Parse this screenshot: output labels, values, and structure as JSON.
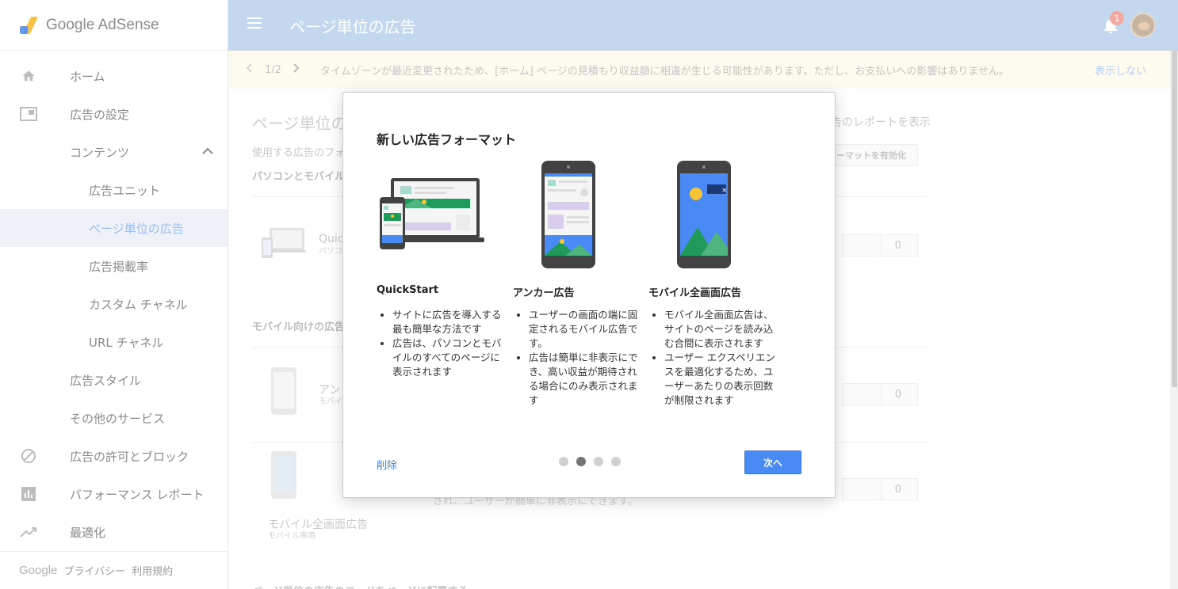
{
  "brand": {
    "name": "Google AdSense"
  },
  "header": {
    "page_title": "ページ単位の広告",
    "notification_count": "1"
  },
  "sidebar": {
    "items": [
      {
        "label": "ホーム",
        "icon": "home-icon"
      },
      {
        "label": "広告の設定",
        "icon": "ads-icon"
      },
      {
        "label": "コンテンツ",
        "icon": "chevron-up-icon"
      },
      {
        "label": "広告ユニット"
      },
      {
        "label": "ページ単位の広告"
      },
      {
        "label": "広告掲載率"
      },
      {
        "label": "カスタム チャネル"
      },
      {
        "label": "URL チャネル"
      },
      {
        "label": "広告スタイル"
      },
      {
        "label": "その他のサービス"
      },
      {
        "label": "広告の許可とブロック",
        "icon": "block-icon"
      },
      {
        "label": "パフォーマンス レポート",
        "icon": "report-icon"
      },
      {
        "label": "最適化",
        "icon": "trending-icon"
      }
    ],
    "footer": {
      "google": "Google",
      "privacy": "プライバシー",
      "terms": "利用規約"
    }
  },
  "notice": {
    "page": "1/2",
    "message": "タイムゾーンが最近変更されたため、[ホーム] ページの見積もり収益額に相違が生じる可能性があります。ただし、お支払いへの影響はありません。",
    "dismiss": "表示しない"
  },
  "main": {
    "title": "ページ単位の広",
    "description": "使用する広告のフォ",
    "section_desktop": "パソコンとモバイル",
    "report_link": "告のレポートを表示",
    "enable_button": "ーマットを有効化",
    "quickstart_label": "Quick",
    "quickstart_sub": "パソコ",
    "section_mobile": "モバイル向けの広告",
    "anchor_label": "アン",
    "anchor_sub": "モバイ",
    "vignette_label": "モバイル全画面広告",
    "vignette_sub": "モバイル専用",
    "vignette_desc": "され、ユーザーが簡単に非表示にできます。",
    "toggle_count_1": "0",
    "toggle_count_2": "0",
    "toggle_count_3": "0",
    "bottom_heading": "ページ単位の広告のコードをページに配置する"
  },
  "dialog": {
    "title": "新しい広告フォーマット",
    "columns": [
      {
        "name": "QuickStart",
        "bullets": [
          "サイトに広告を導入する最も簡単な方法です",
          "広告は、パソコンとモバイルのすべてのページに表示されます"
        ]
      },
      {
        "name": "アンカー広告",
        "bullets": [
          "ユーザーの画面の端に固定されるモバイル広告です。",
          "広告は簡単に非表示にでき、高い収益が期待される場合にのみ表示されます"
        ]
      },
      {
        "name": "モバイル全画面広告",
        "bullets": [
          "モバイル全画面広告は、サイトのページを読み込む合間に表示されます",
          "ユーザー エクスペリエンスを最適化するため、ユーザーあたりの表示回数が制限されます"
        ]
      }
    ],
    "delete_label": "削除",
    "next_label": "次へ",
    "page_dots": 4,
    "active_dot": 2
  },
  "colors": {
    "header_bg": "#c3d8ee",
    "primary_button": "#4a8af4",
    "notice_bg": "#fdfbef",
    "link": "#4a7fd1"
  }
}
